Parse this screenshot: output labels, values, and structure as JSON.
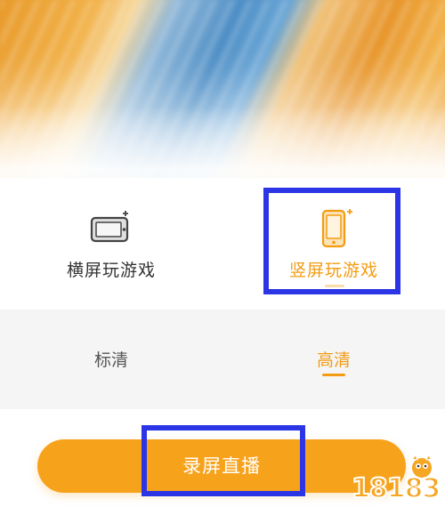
{
  "banner": {
    "icon": "blurred-game-banner"
  },
  "orientation": {
    "landscape": {
      "label": "横屏玩游戏",
      "icon": "landscape-phone-icon",
      "selected": false
    },
    "portrait": {
      "label": "竖屏玩游戏",
      "icon": "portrait-phone-icon",
      "selected": true
    }
  },
  "quality": {
    "standard": {
      "label": "标清",
      "selected": false
    },
    "high": {
      "label": "高清",
      "selected": true
    }
  },
  "action": {
    "start_label": "录屏直播"
  },
  "watermark": {
    "text": "18183"
  },
  "colors": {
    "accent": "#f39c12",
    "button": "#f7a21b",
    "highlight": "#2b35e6",
    "panel_gray": "#f5f5f5"
  }
}
